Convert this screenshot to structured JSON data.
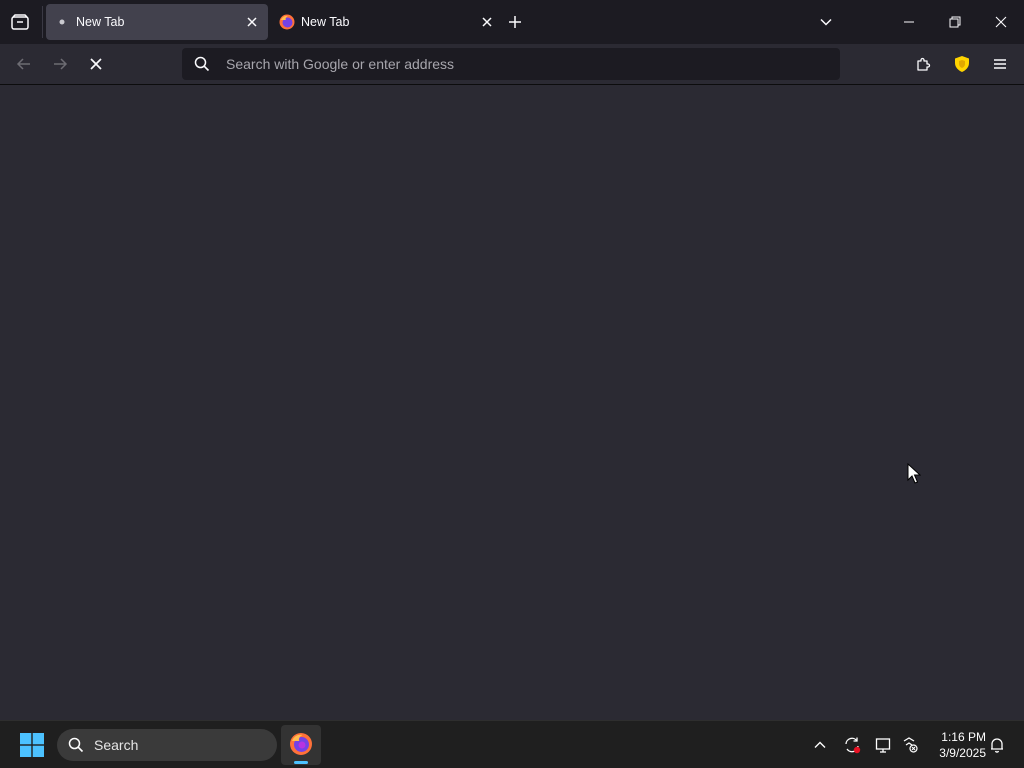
{
  "browser": {
    "tabs": [
      {
        "label": "New Tab",
        "active": true,
        "icon": "dot-icon"
      },
      {
        "label": "New Tab",
        "active": false,
        "icon": "firefox-icon"
      }
    ],
    "urlbar": {
      "placeholder": "Search with Google or enter address",
      "value": ""
    },
    "status": "loading"
  },
  "taskbar": {
    "search_label": "Search",
    "clock": {
      "time": "1:16 PM",
      "date": "3/9/2025"
    }
  },
  "colors": {
    "tabstrip_bg": "#1c1b22",
    "toolbar_bg": "#2b2a33",
    "active_tab": "#42414d",
    "accent": "#4cc2ff",
    "shield": "#ffd400"
  }
}
